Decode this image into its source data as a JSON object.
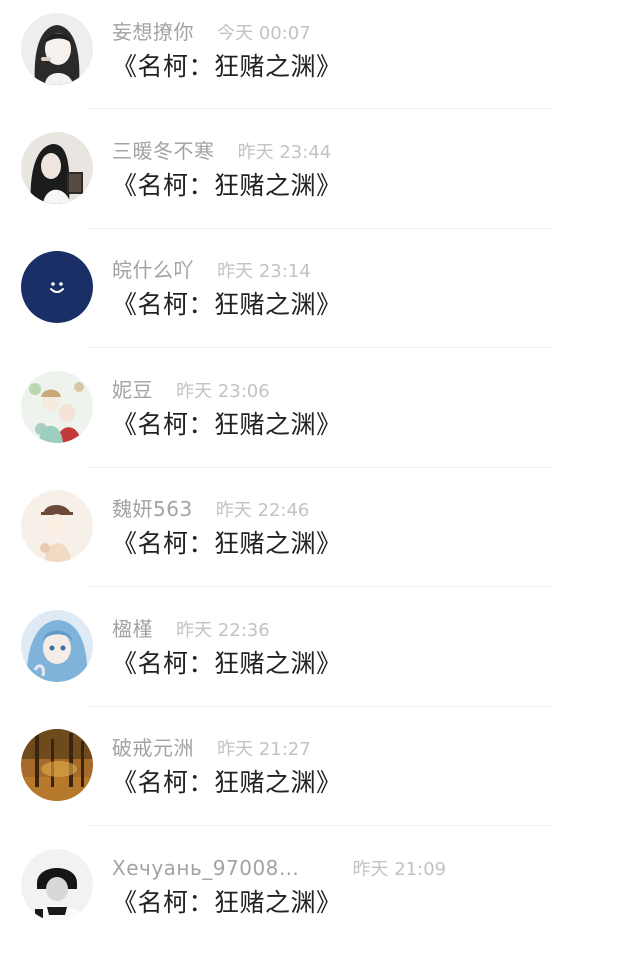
{
  "comments": [
    {
      "name": "妄想撩你",
      "time": "今天 00:07",
      "text": "《名柯：狂赌之渊》"
    },
    {
      "name": "三暖冬不寒",
      "time": "昨天 23:44",
      "text": "《名柯：狂赌之渊》"
    },
    {
      "name": "皖什么吖",
      "time": "昨天 23:14",
      "text": "《名柯：狂赌之渊》"
    },
    {
      "name": "妮豆",
      "time": "昨天 23:06",
      "text": "《名柯：狂赌之渊》"
    },
    {
      "name": "魏妍563",
      "time": "昨天 22:46",
      "text": "《名柯：狂赌之渊》"
    },
    {
      "name": "楹槿",
      "time": "昨天 22:36",
      "text": "《名柯：狂赌之渊》"
    },
    {
      "name": "破戒元洲",
      "time": "昨天 21:27",
      "text": "《名柯：狂赌之渊》"
    },
    {
      "name": "Хечуань_97008…",
      "time": "昨天 21:09",
      "text": "《名柯：狂赌之渊》"
    }
  ],
  "avatar_icons": [
    "girl-sketch-avatar",
    "girl-reading-avatar",
    "smiley-navy-avatar",
    "anime-flowers-avatar",
    "cartoon-girl-avatar",
    "anime-blue-hair-avatar",
    "autumn-forest-avatar",
    "hoodie-man-avatar"
  ],
  "colors": {
    "name": "#a3a3a3",
    "time": "#c3c3c3",
    "comment": "#222222",
    "divider": "#efefef",
    "navy_avatar": "#1a2f66"
  }
}
